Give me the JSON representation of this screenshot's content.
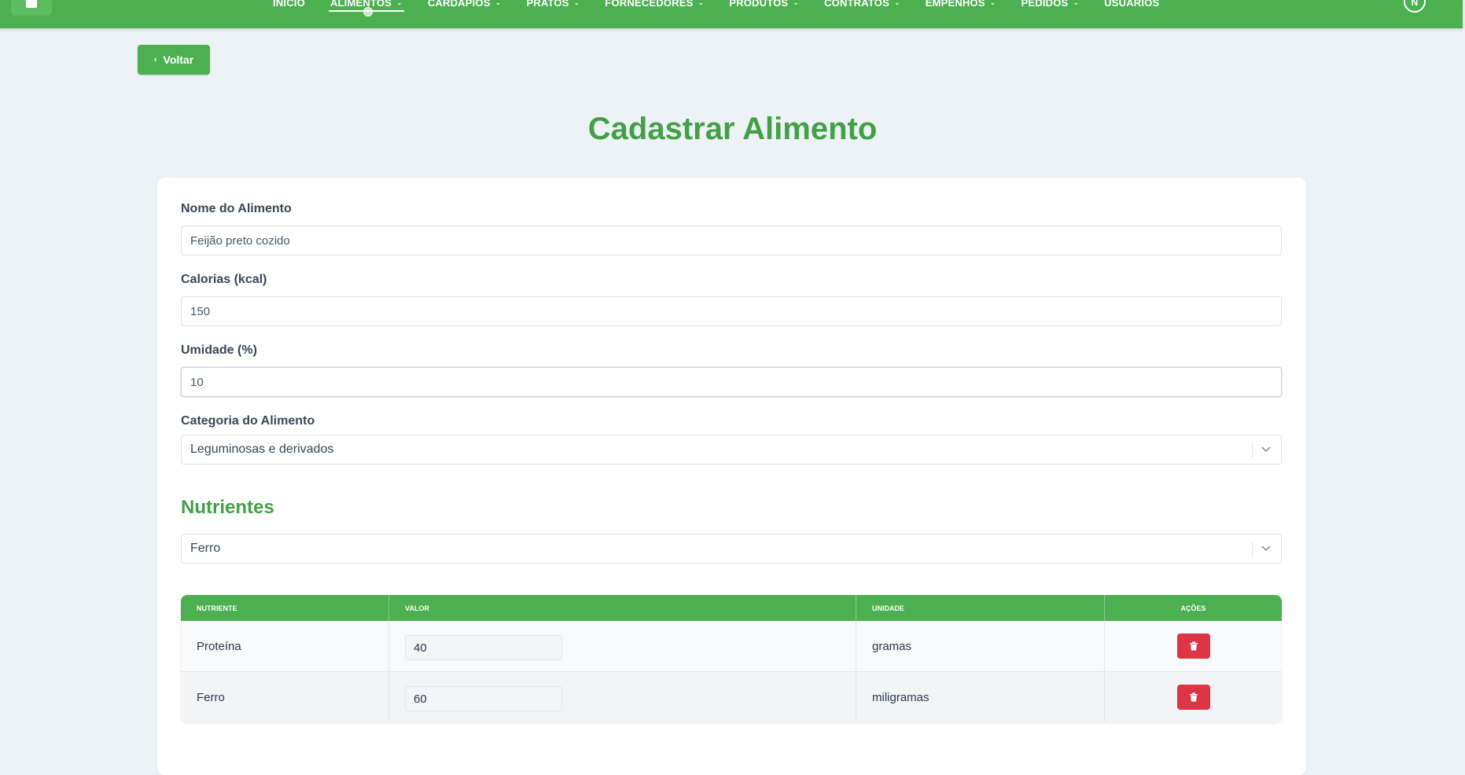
{
  "nav": {
    "items": [
      {
        "label": "INÍCIO",
        "has_dropdown": false,
        "active": false
      },
      {
        "label": "ALIMENTOS",
        "has_dropdown": true,
        "active": true
      },
      {
        "label": "CARDÁPIOS",
        "has_dropdown": true,
        "active": false
      },
      {
        "label": "PRATOS",
        "has_dropdown": true,
        "active": false
      },
      {
        "label": "FORNECEDORES",
        "has_dropdown": true,
        "active": false
      },
      {
        "label": "PRODUTOS",
        "has_dropdown": true,
        "active": false
      },
      {
        "label": "CONTRATOS",
        "has_dropdown": true,
        "active": false
      },
      {
        "label": "EMPENHOS",
        "has_dropdown": true,
        "active": false
      },
      {
        "label": "PEDIDOS",
        "has_dropdown": true,
        "active": false
      },
      {
        "label": "USUÁRIOS",
        "has_dropdown": false,
        "active": false
      }
    ],
    "avatar_initial": "N",
    "logo_icon": "book-icon"
  },
  "back_button": {
    "label": "Voltar",
    "icon": "chevron-left-icon"
  },
  "page_title": "Cadastrar Alimento",
  "form": {
    "nome": {
      "label": "Nome do Alimento",
      "value": "Feijão preto cozido"
    },
    "calorias": {
      "label": "Calorias (kcal)",
      "value": "150"
    },
    "umidade": {
      "label": "Umidade (%)",
      "value": "10"
    },
    "categoria": {
      "label": "Categoria do Alimento",
      "value": "Leguminosas e derivados"
    }
  },
  "nutrientes": {
    "title": "Nutrientes",
    "select_value": "Ferro",
    "table": {
      "headers": [
        "NUTRIENTE",
        "VALOR",
        "UNIDADE",
        "AÇÕES"
      ],
      "rows": [
        {
          "nutriente": "Proteína",
          "valor": "40",
          "unidade": "gramas"
        },
        {
          "nutriente": "Ferro",
          "valor": "60",
          "unidade": "miligramas"
        }
      ]
    }
  },
  "colors": {
    "primary": "#4caf50",
    "title_green": "#43a047",
    "danger": "#dc3545",
    "background": "#edf2f6"
  }
}
